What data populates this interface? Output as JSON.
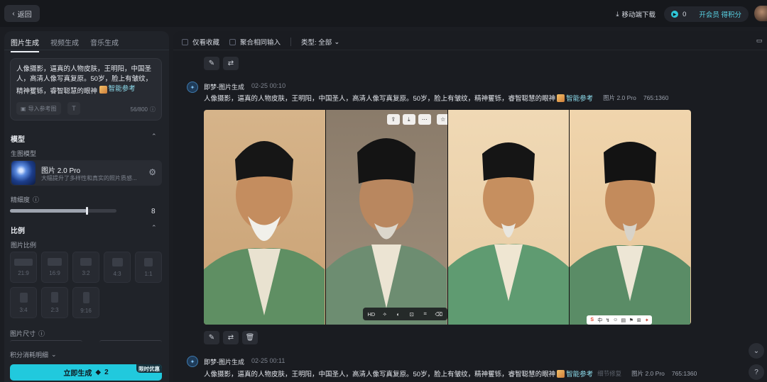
{
  "topbar": {
    "back_label": "返回",
    "mobile_download": "移动端下载",
    "credits": "0",
    "vip_label": "开会员 得积分"
  },
  "left": {
    "tabs": [
      "图片生成",
      "视频生成",
      "音乐生成"
    ],
    "prompt_text": "人像摄影，逼真的人物皮肤，王明阳，中国圣人，高清人像写真复原。50岁，脸上有皱纹，精神矍铄，睿智聪慧的眼神",
    "prompt_chip": "智能参考",
    "ref_button": "导入参考图",
    "t_button": "T",
    "char_count": "56/800",
    "model_section": "模型",
    "gen_model_label": "生图模型",
    "model_name": "图片 2.0 Pro",
    "model_desc": "大幅提升了多样性和真实的照片质感...",
    "detail_label": "精细度",
    "detail_value": "8",
    "detail_fraction": 0.72,
    "ratio_section": "比例",
    "ratio_label": "图片比例",
    "ratios": [
      "21:9",
      "16:9",
      "3:2",
      "4:3",
      "1:1",
      "3:4",
      "2:3",
      "9:16"
    ],
    "size_label": "图片尺寸",
    "credit_detail": "积分消耗明细",
    "generate_label": "立即生成",
    "generate_cost": "2",
    "promo_badge": "限时优惠"
  },
  "main": {
    "filter_favorites": "仅看收藏",
    "filter_merge": "聚合相同输入",
    "type_filter": "类型: 全部",
    "messages": [
      {
        "sender": "即梦-图片生成",
        "date": "02-25",
        "time": "00:10",
        "text": "人像摄影，逼真的人物皮肤，王明阳，中国圣人，高清人像写真复原。50岁，脸上有皱纹，精神矍铄，睿智聪慧的眼神",
        "chip": "智能参考",
        "model": "图片 2.0 Pro",
        "size": "765:1360"
      },
      {
        "sender": "即梦-图片生成",
        "date": "02-25",
        "time": "00:11",
        "text": "人像摄影，逼真的人物皮肤，王明阳，中国圣人，高清人像写真复原。50岁，脸上有皱纹，精神矍铄，睿智聪慧的眼神",
        "chip": "智能参考",
        "extra": "细节修复",
        "model": "图片 2.0 Pro",
        "size": "765:1360"
      }
    ],
    "image_toolbar_hd": "HD",
    "ime_bar": [
      "S",
      "中",
      "↯",
      "☺",
      "▤",
      "⚑",
      "⊞",
      "✦"
    ]
  },
  "colors": {
    "accent": "#21c9dd",
    "bg": "#1a1c21",
    "panel": "#202329"
  }
}
